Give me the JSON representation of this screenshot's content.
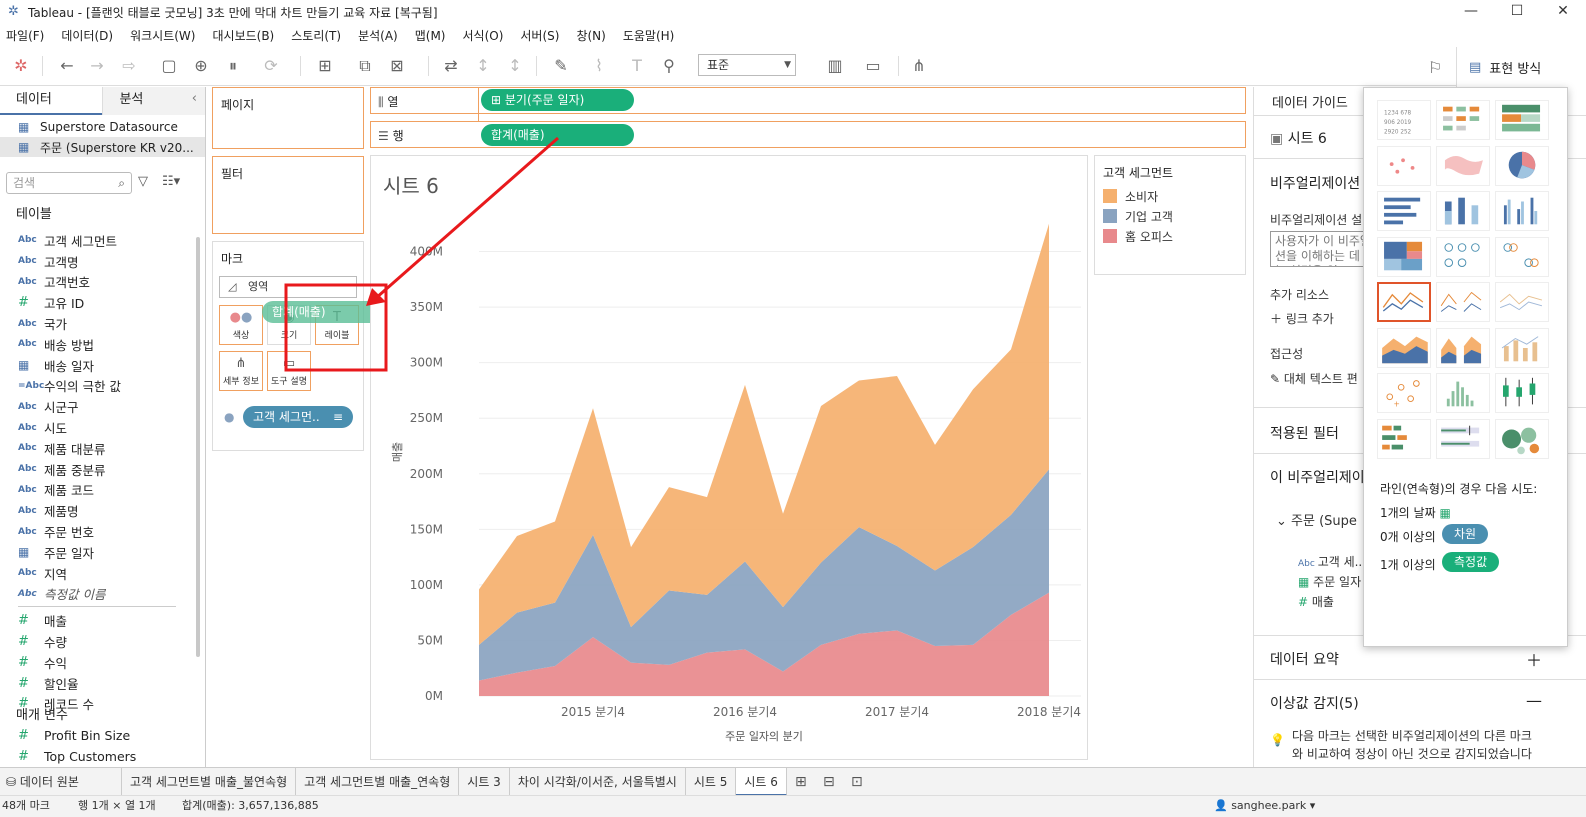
{
  "window": {
    "title": "Tableau - [플랜잇 태블로 굿모닝] 3초 만에 막대 차트 만들기 교육 자료 [복구됨]",
    "minimize": "—",
    "maximize": "☐",
    "close": "✕"
  },
  "menu": [
    "파일(F)",
    "데이터(D)",
    "워크시트(W)",
    "대시보드(B)",
    "스토리(T)",
    "분석(A)",
    "맵(M)",
    "서식(O)",
    "서버(S)",
    "창(N)",
    "도움말(H)"
  ],
  "toolbar": {
    "fit": "표준",
    "showme": "표현 방식"
  },
  "datapane": {
    "tab_data": "데이터",
    "tab_analysis": "분석",
    "sources": [
      "Superstore Datasource",
      "주문 (Superstore KR v20..."
    ],
    "search_placeholder": "검색",
    "tables_title": "테이블",
    "fields": [
      {
        "type": "Abc",
        "name": "고객 세그먼트"
      },
      {
        "type": "Abc",
        "name": "고객명"
      },
      {
        "type": "Abc",
        "name": "고객번호"
      },
      {
        "type": "#",
        "name": "고유 ID"
      },
      {
        "type": "Abc",
        "name": "국가"
      },
      {
        "type": "Abc",
        "name": "배송 방법"
      },
      {
        "type": "date",
        "name": "배송 일자"
      },
      {
        "type": "=Abc",
        "name": "수익의 극한 값"
      },
      {
        "type": "Abc",
        "name": "시군구"
      },
      {
        "type": "Abc",
        "name": "시도"
      },
      {
        "type": "Abc",
        "name": "제품 대분류"
      },
      {
        "type": "Abc",
        "name": "제품 중분류"
      },
      {
        "type": "Abc",
        "name": "제품 코드"
      },
      {
        "type": "Abc",
        "name": "제품명"
      },
      {
        "type": "Abc",
        "name": "주문 번호"
      },
      {
        "type": "date",
        "name": "주문 일자"
      },
      {
        "type": "Abc",
        "name": "지역"
      },
      {
        "type": "Abc",
        "name": "측정값 이름"
      }
    ],
    "measures": [
      "매출",
      "수량",
      "수익",
      "할인율",
      "레코드 수"
    ],
    "params_title": "매개 변수",
    "params": [
      "Profit Bin Size",
      "Top Customers"
    ]
  },
  "shelves": {
    "pages": "페이지",
    "filters": "필터",
    "marks": "마크",
    "mark_type": "영역",
    "mark_buttons": [
      "색상",
      "크기",
      "레이블",
      "세부 정보",
      "도구 설명"
    ],
    "color_pill": "고객 세그먼..",
    "drag_pill": "합계(매출)",
    "columns_label": "열",
    "rows_label": "행",
    "columns_pill": "⊞ 분기(주문 일자)",
    "rows_pill": "합계(매출)"
  },
  "view": {
    "sheet_title": "시트 6"
  },
  "chart_data": {
    "type": "area",
    "stacked": true,
    "xlabel": "주문 일자의 분기",
    "ylabel": "매출",
    "ylim": [
      0,
      450000000
    ],
    "y_ticks": [
      "0M",
      "50M",
      "100M",
      "150M",
      "200M",
      "250M",
      "300M",
      "350M",
      "400M"
    ],
    "x_tick_labels": [
      "2015 분기4",
      "2016 분기4",
      "2017 분기4",
      "2018 분기4"
    ],
    "x": [
      "2015 Q1",
      "2015 Q2",
      "2015 Q3",
      "2015 Q4",
      "2016 Q1",
      "2016 Q2",
      "2016 Q3",
      "2016 Q4",
      "2017 Q1",
      "2017 Q2",
      "2017 Q3",
      "2017 Q4",
      "2018 Q1",
      "2018 Q2",
      "2018 Q3",
      "2018 Q4"
    ],
    "legend_title": "고객 세그먼트",
    "legend_position": "right",
    "series": [
      {
        "name": "홈 오피스",
        "color": "#e8898c",
        "values": [
          14000000,
          21000000,
          27000000,
          53000000,
          30000000,
          28000000,
          39000000,
          42000000,
          22000000,
          46000000,
          56000000,
          59000000,
          45000000,
          46000000,
          73000000,
          93000000
        ]
      },
      {
        "name": "기업 고객",
        "color": "#8aa3c0",
        "values": [
          32000000,
          54000000,
          57000000,
          92000000,
          32000000,
          67000000,
          52000000,
          79000000,
          58000000,
          74000000,
          96000000,
          76000000,
          68000000,
          88000000,
          90000000,
          111000000
        ]
      },
      {
        "name": "소비자",
        "color": "#f5b06e",
        "values": [
          50000000,
          69000000,
          73000000,
          114000000,
          72000000,
          93000000,
          88000000,
          159000000,
          84000000,
          141000000,
          132000000,
          153000000,
          113000000,
          142000000,
          149000000,
          221000000
        ]
      }
    ]
  },
  "guide": {
    "title": "데이터 가이드",
    "sheet": "시트 6",
    "viz_desc_head": "비주얼리제이션",
    "viz_desc_label": "비주얼리제이션 설",
    "viz_desc_placeholder": "사용자가 이 비주얼리제이션을 이해하는 데 도움이 되는 설명을 입",
    "resources": "추가 리소스",
    "add_link": "링크 추가",
    "accessibility": "접근성",
    "alt_text": "대체 텍스트 편",
    "applied_filters": "적용된 필터",
    "this_viz": "이 비주얼리제이",
    "source_node": "주문 (Supe",
    "src_fields": [
      "고객 세..",
      "주문 일자",
      "매출"
    ],
    "data_summary": "데이터 요약",
    "outliers": "이상값 감지(5)",
    "outlier_desc": "다음 마크는 선택한 비주얼리제이션의 다른 마크와 비교하여 정상이 아닌 것으로 감지되었습니다"
  },
  "showme": {
    "hint": "라인(연속형)의 경우 다음 시도:",
    "req1": "1개의 날짜",
    "req2": "0개 이상의",
    "req2_pill": "차원",
    "req3": "1개 이상의",
    "req3_pill": "측정값"
  },
  "bottom": {
    "datasource": "데이터 원본",
    "tabs": [
      "고객 세그먼트별 매출_불연속형",
      "고객 세그먼트별 매출_연속형",
      "시트 3",
      "차이 시각화/이서준, 서울특별시",
      "시트 5",
      "시트 6"
    ],
    "active_tab": "시트 6"
  },
  "status": {
    "marks": "48개 마크",
    "rows": "행 1개 × 열 1개",
    "sum": "합계(매출): 3,657,136,885",
    "user": "sanghee.park"
  }
}
